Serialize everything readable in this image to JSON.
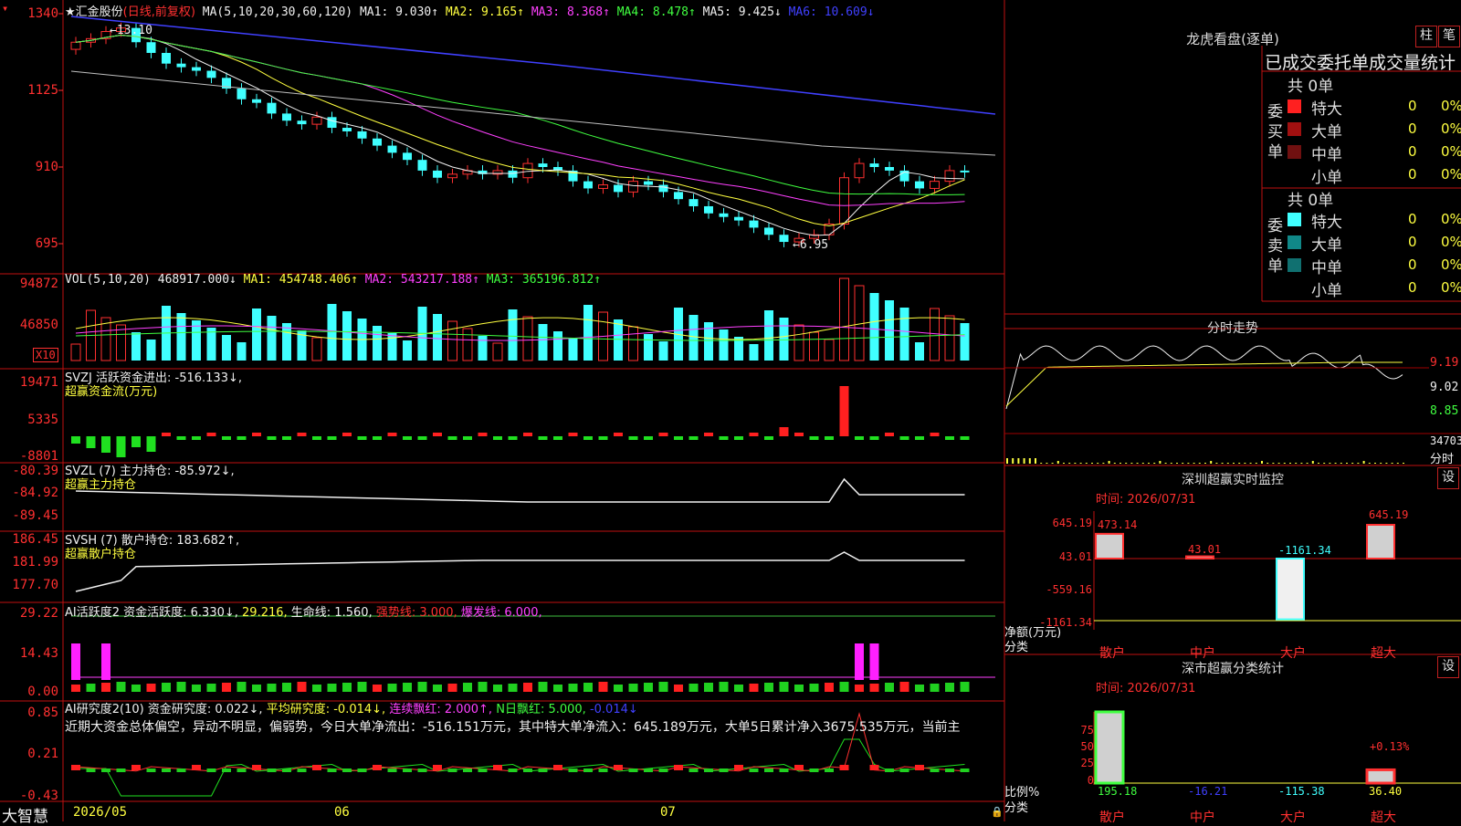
{
  "stock": {
    "name": "★汇金股份",
    "period": "(日线,前复权)"
  },
  "ma_header": {
    "label": "MA(5,10,20,30,60,120)",
    "items": [
      {
        "text": "MA1: 9.030↑",
        "color": "#f0f0f0"
      },
      {
        "text": "MA2: 9.165↑",
        "color": "#ffff40"
      },
      {
        "text": "MA3: 8.368↑",
        "color": "#ff40ff"
      },
      {
        "text": "MA4: 8.478↑",
        "color": "#40ff40"
      },
      {
        "text": "MA5: 9.425↓",
        "color": "#f0f0f0"
      },
      {
        "text": "MA6: 10.609↓",
        "color": "#4040ff"
      }
    ]
  },
  "price_axis": [
    "1340",
    "1125",
    "910",
    "695"
  ],
  "price_annotations": {
    "high": "←13.10",
    "low": "←6.95"
  },
  "vol_header": {
    "label": "VOL(5,10,20)",
    "value": "468917.000↓",
    "items": [
      {
        "text": "MA1: 454748.406↑",
        "color": "#ffff40"
      },
      {
        "text": "MA2: 543217.188↑",
        "color": "#ff40ff"
      },
      {
        "text": "MA3: 365196.812↑",
        "color": "#40ff40"
      }
    ]
  },
  "vol_axis": [
    "94872",
    "46850"
  ],
  "vol_unit": "X10",
  "svzj": {
    "line1": "SVZJ  活跃资金进出: -516.133↓,",
    "line2": "超赢资金流(万元)",
    "axis": [
      "19471",
      "5335",
      "-8801"
    ]
  },
  "svzl": {
    "line1": "SVZL (7) 主力持仓: -85.972↓,",
    "line2": "超赢主力持仓",
    "axis": [
      "-80.39",
      "-84.92",
      "-89.45"
    ]
  },
  "svsh": {
    "line1": "SVSH (7) 散户持仓: 183.682↑,",
    "line2": "超赢散户持仓",
    "axis": [
      "186.45",
      "181.99",
      "177.70"
    ]
  },
  "ai_active": {
    "items": [
      {
        "text": "AI活跃度2 资金活跃度: 6.330↓,",
        "color": "#f0f0f0"
      },
      {
        "text": "29.216,",
        "color": "#ffff40"
      },
      {
        "text": "生命线: 1.560,",
        "color": "#f0f0f0"
      },
      {
        "text": "强势线: 3.000,",
        "color": "#ff3030"
      },
      {
        "text": "爆发线: 6.000,",
        "color": "#ff40ff"
      }
    ],
    "axis": [
      "29.22",
      "14.43",
      "0.00"
    ]
  },
  "ai_research": {
    "items": [
      {
        "text": "AI研究度2(10) 资金研究度: 0.022↓,",
        "color": "#f0f0f0"
      },
      {
        "text": "平均研究度: -0.014↓,",
        "color": "#ffff40"
      },
      {
        "text": "连续飘红: 2.000↑,",
        "color": "#ff40ff"
      },
      {
        "text": "N日飘红: 5.000,",
        "color": "#40ff40"
      },
      {
        "text": "-0.014↓",
        "color": "#4040ff"
      }
    ],
    "summary": "近期大资金总体偏空，异动不明显，偏弱势，今日大单净流出：-516.151万元，其中特大单净流入：645.189万元，大单5日累计净入3675.535万元，当前主",
    "axis": [
      "0.85",
      "0.21",
      "-0.43"
    ]
  },
  "bottom": {
    "brand": "大智慧",
    "dates": [
      "2026/05",
      "06",
      "07"
    ]
  },
  "right": {
    "lhb": {
      "title": "龙虎看盘(逐单)",
      "btn1": "柱",
      "btn2": "笔",
      "header": "已成交委托单成交量统计"
    },
    "buy": {
      "side": [
        "委",
        "买",
        "单"
      ],
      "total": "共 0单",
      "rows": [
        {
          "name": "特大",
          "v": "0",
          "p": "0%",
          "color": "#ff2020"
        },
        {
          "name": "大单",
          "v": "0",
          "p": "0%",
          "color": "#a01010"
        },
        {
          "name": "中单",
          "v": "0",
          "p": "0%",
          "color": "#701010"
        },
        {
          "name": "小单",
          "v": "0",
          "p": "0%",
          "color": "#000000"
        }
      ]
    },
    "sell": {
      "side": [
        "委",
        "卖",
        "单"
      ],
      "total": "共 0单",
      "rows": [
        {
          "name": "特大",
          "v": "0",
          "p": "0%",
          "color": "#40ffff"
        },
        {
          "name": "大单",
          "v": "0",
          "p": "0%",
          "color": "#108888"
        },
        {
          "name": "中单",
          "v": "0",
          "p": "0%",
          "color": "#107070"
        },
        {
          "name": "小单",
          "v": "0",
          "p": "0%",
          "color": "#000000"
        }
      ]
    },
    "intraday": {
      "title": "分时走势",
      "axis": [
        "9.19",
        "9.02",
        "8.85"
      ],
      "vol": "34703",
      "vol_label": "分时"
    },
    "monitor": {
      "title": "深圳超赢实时监控",
      "btn": "设",
      "time": "时间: 2026/07/31",
      "axis": [
        "645.19",
        "43.01",
        "-559.16",
        "-1161.34"
      ],
      "ylabel": "净额(万元)",
      "xlabel": "分类",
      "bars": [
        {
          "cat": "散户",
          "value": 473.14,
          "label": "473.14"
        },
        {
          "cat": "中户",
          "value": 43.01,
          "label": "43.01"
        },
        {
          "cat": "大户",
          "value": -1161.34,
          "label": "-1161.34"
        },
        {
          "cat": "超大",
          "value": 645.19,
          "label": "645.19"
        }
      ]
    },
    "classify": {
      "title": "深市超赢分类统计",
      "btn": "设",
      "time": "时间: 2026/07/31",
      "axis": [
        "75",
        "50",
        "25",
        "0"
      ],
      "ylabel": "比例%",
      "xlabel": "分类",
      "pct_label": "+0.13%",
      "bars": [
        {
          "cat": "散户",
          "value": 195.18,
          "label": "195.18",
          "color": "#40ff40"
        },
        {
          "cat": "中户",
          "value": -16.21,
          "label": "-16.21",
          "color": "#4040ff"
        },
        {
          "cat": "大户",
          "value": -115.38,
          "label": "-115.38",
          "color": "#40ffff"
        },
        {
          "cat": "超大",
          "value": 36.4,
          "label": "36.40",
          "color": "#ffff40"
        }
      ]
    }
  }
}
